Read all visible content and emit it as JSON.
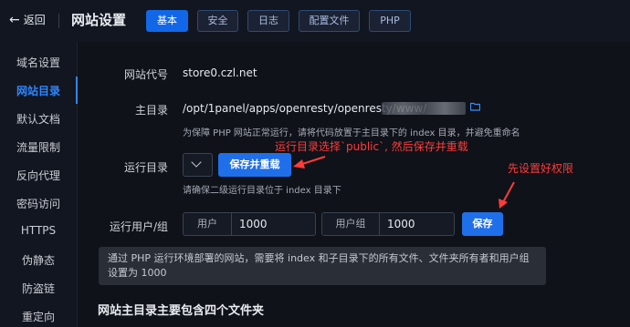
{
  "header": {
    "back_label": "返回",
    "title": "网站设置",
    "tabs": [
      {
        "label": "基本",
        "active": true
      },
      {
        "label": "安全",
        "active": false
      },
      {
        "label": "日志",
        "active": false
      },
      {
        "label": "配置文件",
        "active": false
      },
      {
        "label": "PHP",
        "active": false
      }
    ]
  },
  "sidebar": {
    "items": [
      {
        "label": "域名设置",
        "active": false
      },
      {
        "label": "网站目录",
        "active": true
      },
      {
        "label": "默认文档",
        "active": false
      },
      {
        "label": "流量限制",
        "active": false
      },
      {
        "label": "反向代理",
        "active": false
      },
      {
        "label": "密码访问",
        "active": false
      },
      {
        "label": "HTTPS",
        "active": false
      },
      {
        "label": "伪静态",
        "active": false
      },
      {
        "label": "防盗链",
        "active": false
      },
      {
        "label": "重定向",
        "active": false
      }
    ]
  },
  "form": {
    "alias_label": "网站代号",
    "alias_value": "store0.czl.net",
    "root_label": "主目录",
    "root_value": "/opt/1panel/apps/openresty/openresty/www/",
    "root_hint": "为保障 PHP 网站正常运行，请将代码放置于主目录下的 index 目录，并避免重命名",
    "run_dir_label": "运行目录",
    "save_reload_label": "保存并重载",
    "run_dir_hint": "请确保二级运行目录位于 index 目录下",
    "run_user_label": "运行用户/组",
    "user_addon": "用户",
    "user_value": "1000",
    "group_addon": "用户组",
    "group_value": "1000",
    "save_label": "保存"
  },
  "annotations": {
    "note1": "运行目录选择`public`, 然后保存并重载",
    "note2": "先设置好权限",
    "color": "#ff3b3b"
  },
  "info_text": "通过 PHP 运行环境部署的网站，需要将 index 和子目录下的所有文件、文件夹所有者和用户组设置为 1000",
  "section_heading": "网站主目录主要包含四个文件夹",
  "colors": {
    "accent": "#1f6fea",
    "background": "#0f1218",
    "annotation": "#ff3b3b"
  }
}
